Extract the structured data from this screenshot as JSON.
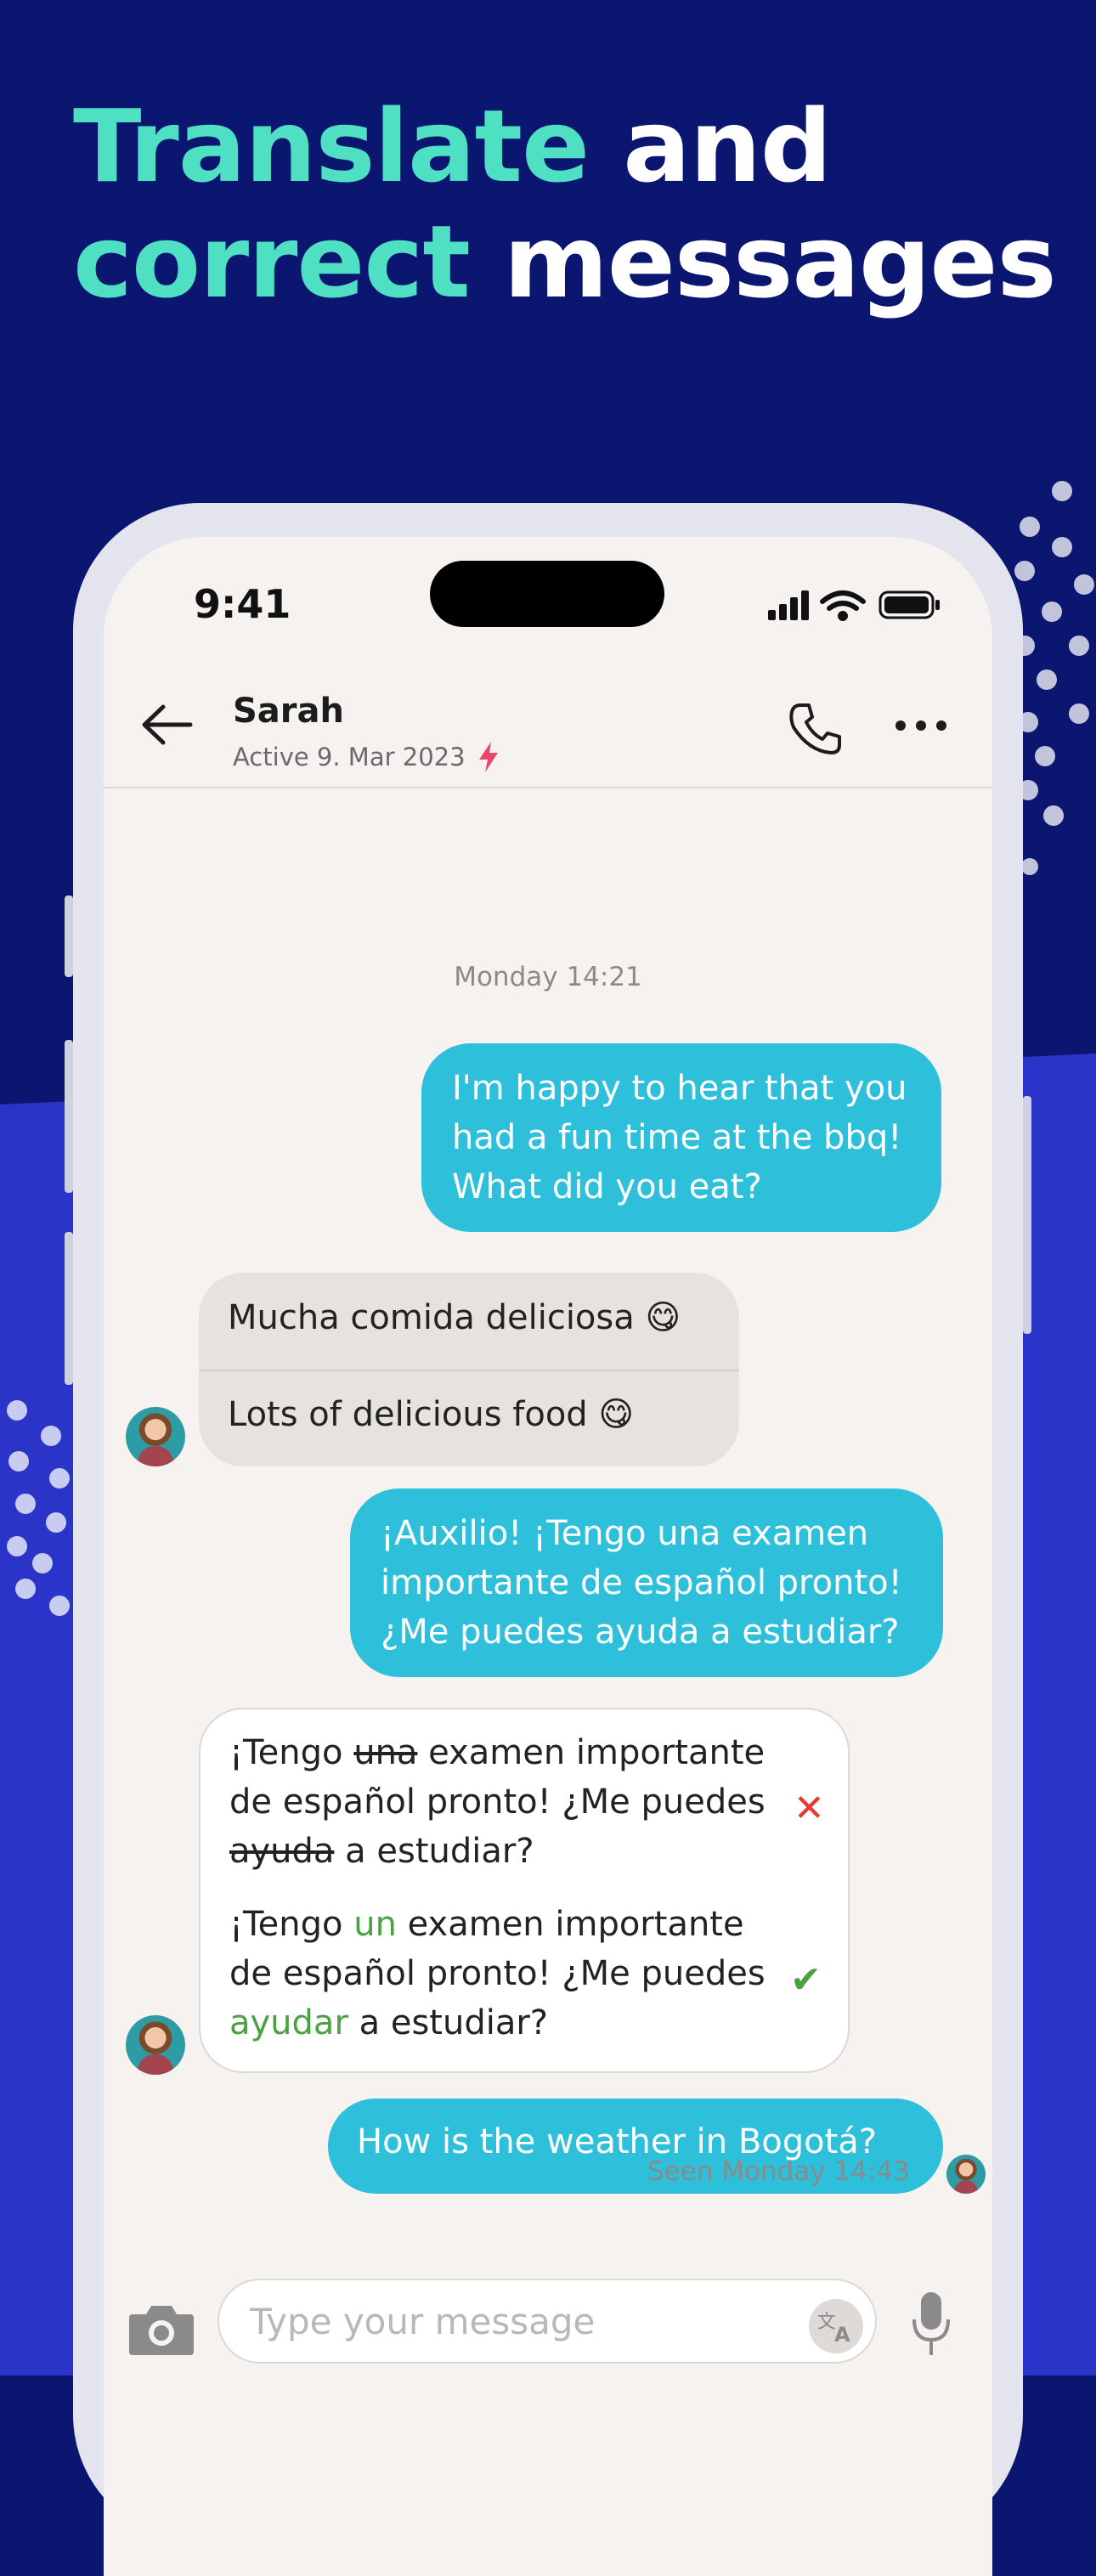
{
  "headline": {
    "line1_accent": "Translate",
    "line1_rest": " and",
    "line2_accent": "correct",
    "line2_rest": " messages"
  },
  "status_bar": {
    "time": "9:41"
  },
  "chat_header": {
    "contact_name": "Sarah",
    "status": "Active 9. Mar 2023",
    "icons": [
      "back-arrow-icon",
      "bolt-icon",
      "phone-icon",
      "more-icon"
    ]
  },
  "conversation": {
    "day_label": "Monday 14:21",
    "msg1_lines": [
      "I'm happy to hear that you",
      "had a fun time at the bbq!",
      "What did you eat?"
    ],
    "msg2": {
      "original": "Mucha comida deliciosa 😋",
      "translation": "Lots of delicious food 😋"
    },
    "msg3_lines": [
      "¡Auxilio! ¡Tengo una examen",
      "importante de español pronto!",
      "¿Me puedes ayuda a estudiar?"
    ],
    "correction": {
      "wrong": {
        "l1_a": "¡Tengo ",
        "l1_strike": "una",
        "l1_b": " examen importante",
        "l2": "de español pronto! ¿Me puedes",
        "l3_strike": "ayuda",
        "l3_b": " a estudiar?"
      },
      "right": {
        "l1_a": "¡Tengo ",
        "l1_green": "un",
        "l1_b": " examen importante",
        "l2": "de español pronto! ¿Me puedes",
        "l3_green": "ayudar",
        "l3_b": " a estudiar?"
      },
      "wrong_mark": "✕",
      "right_mark": "✔"
    },
    "msg5": "How is the weather in Bogotá?",
    "seen": "Seen Monday 14:43"
  },
  "composer": {
    "placeholder": "Type your message",
    "icons": [
      "camera-icon",
      "translate-icon",
      "microphone-icon"
    ]
  },
  "colors": {
    "background_dark": "#0b1670",
    "background_light": "#2a34c9",
    "accent_teal": "#4fe0c4",
    "outgoing_bubble": "#2ebfda",
    "correct_green": "#4ba143",
    "wrong_red": "#e53935"
  }
}
